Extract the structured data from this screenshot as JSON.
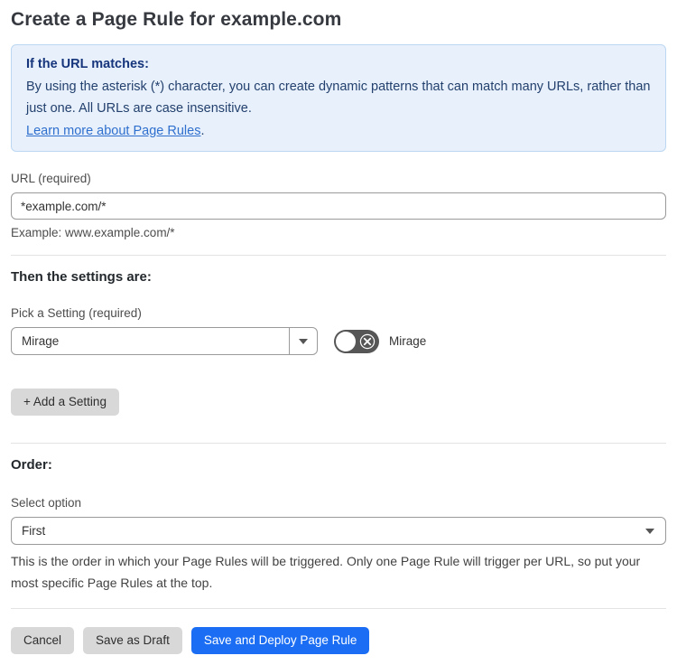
{
  "page": {
    "title": "Create a Page Rule for example.com"
  },
  "info_box": {
    "heading": "If the URL matches:",
    "body": "By using the asterisk (*) character, you can create dynamic patterns that can match many URLs, rather than just one. All URLs are case insensitive.",
    "link_label": "Learn more about Page Rules",
    "link_suffix": "."
  },
  "url_field": {
    "label": "URL (required)",
    "value": "*example.com/*",
    "hint": "Example: www.example.com/*"
  },
  "settings_section": {
    "heading": "Then the settings are:",
    "picker_label": "Pick a Setting (required)",
    "selected_setting": "Mirage",
    "toggle": {
      "state": "off",
      "label": "Mirage"
    },
    "add_button_label": "+ Add a Setting"
  },
  "order_section": {
    "heading": "Order:",
    "select_label": "Select option",
    "selected_option": "First",
    "help_text": "This is the order in which your Page Rules will be triggered. Only one Page Rule will trigger per URL, so put your most specific Page Rules at the top."
  },
  "footer": {
    "cancel_label": "Cancel",
    "save_draft_label": "Save as Draft",
    "save_deploy_label": "Save and Deploy Page Rule"
  },
  "icons": {
    "dropdown_caret": "caret-down-triangle",
    "toggle_off": "x-in-circle"
  },
  "colors": {
    "info_bg": "#e8f1fb",
    "info_border": "#bcd7f2",
    "info_heading": "#16357c",
    "info_text": "#23406e",
    "link": "#2f6fce",
    "primary_button": "#1b6ef3",
    "gray_button": "#d8d8d8",
    "toggle_off_bg": "#565656",
    "input_border": "#9a9a9a",
    "divider": "#e3e3e3"
  }
}
